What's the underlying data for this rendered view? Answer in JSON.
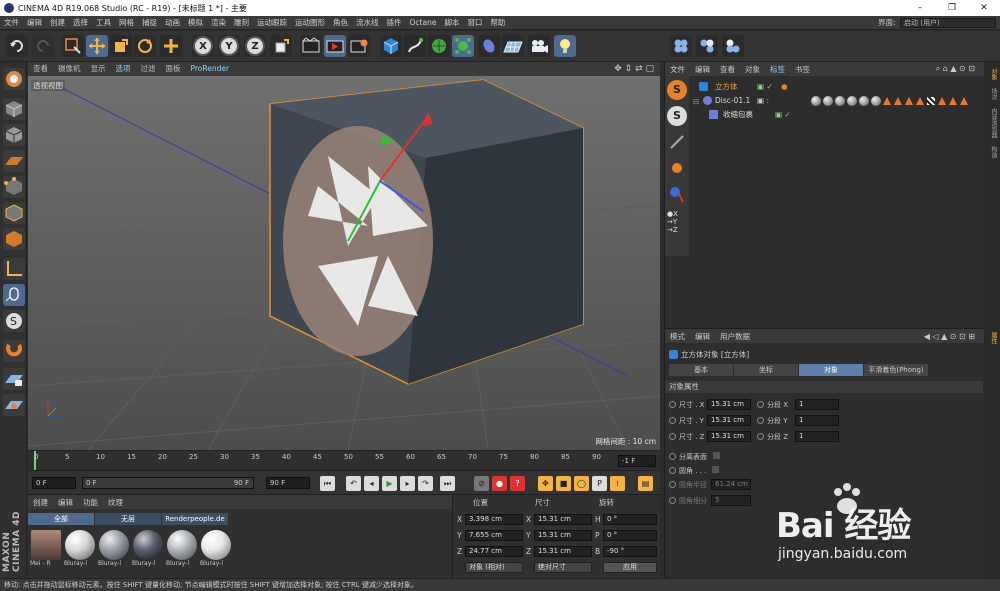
{
  "window": {
    "title": "CINEMA 4D R19.068 Studio (RC - R19) - [未标题 1 *] - 主要",
    "minimize": "–",
    "maximize": "❐",
    "close": "✕"
  },
  "menu": {
    "items": [
      "文件",
      "编辑",
      "创建",
      "选择",
      "工具",
      "网格",
      "捕捉",
      "动画",
      "模拟",
      "渲染",
      "雕刻",
      "运动跟踪",
      "运动图形",
      "角色",
      "流水线",
      "插件",
      "Octane",
      "脚本",
      "窗口",
      "帮助"
    ],
    "layout_label": "界面:",
    "layout_value": "启动 (用户)"
  },
  "toolbar": {
    "x_label": "X",
    "y_label": "Y",
    "z_label": "Z"
  },
  "viewport": {
    "menu": [
      "查看",
      "摄像机",
      "显示",
      "选项",
      "过滤",
      "面板",
      "ProRender"
    ],
    "active_menu_index": 3,
    "label": "透视视图",
    "grid_spacing": "网格间距 : 10 cm"
  },
  "timeline": {
    "ticks": [
      "0",
      "5",
      "10",
      "15",
      "20",
      "25",
      "30",
      "35",
      "40",
      "45",
      "50",
      "55",
      "60",
      "65",
      "70",
      "75",
      "80",
      "85",
      "90"
    ],
    "end_frame": "-1 F",
    "start_field": "0 F",
    "range_start": "0 F",
    "range_end": "90 F",
    "max_field": "90 F"
  },
  "materials": {
    "tabs": [
      "创建",
      "编辑",
      "功能",
      "纹理"
    ],
    "layers": [
      "全部",
      "无层",
      "Renderpeople.de"
    ],
    "items": [
      {
        "name": "Mei - R",
        "color": "#8a6a5a"
      },
      {
        "name": "Bluray-l",
        "color": "#d8d8d8"
      },
      {
        "name": "Bluray-l",
        "color": "#9aa0aa"
      },
      {
        "name": "Bluray-l",
        "color": "#5a6070"
      },
      {
        "name": "Bluray-l",
        "color": "#b0b4b8"
      },
      {
        "name": "Bluray-l",
        "color": "#e8e8e8"
      }
    ]
  },
  "coordinates": {
    "headers": {
      "position": "位置",
      "size": "尺寸",
      "rotation": "旋转"
    },
    "rows": [
      {
        "axis": "X",
        "pos": "3.398 cm",
        "size_axis": "X",
        "size": "15.31 cm",
        "rot_axis": "H",
        "rot": "0 °"
      },
      {
        "axis": "Y",
        "pos": "7.655 cm",
        "size_axis": "Y",
        "size": "15.31 cm",
        "rot_axis": "P",
        "rot": "0 °"
      },
      {
        "axis": "Z",
        "pos": "24.77 cm",
        "size_axis": "Z",
        "size": "15.31 cm",
        "rot_axis": "B",
        "rot": "-90 °"
      }
    ],
    "mode": "对象 (相对)",
    "size_mode": "绝对尺寸",
    "apply": "应用"
  },
  "objects": {
    "menu": [
      "文件",
      "编辑",
      "查看",
      "对象",
      "标签",
      "书签"
    ],
    "rows": [
      {
        "name": "立方体",
        "color": "#f0a030"
      },
      {
        "name": "Disc-01.1",
        "color": "#c8c8c8"
      },
      {
        "name": "收缩包裹",
        "color": "#c8c8c8"
      }
    ]
  },
  "right_tabs": [
    "对象",
    "场次",
    "内容浏览器",
    "构造"
  ],
  "attributes": {
    "menu": [
      "模式",
      "编辑",
      "用户数据"
    ],
    "title": "立方体对象 [立方体]",
    "tabs": [
      "基本",
      "坐标",
      "对象",
      "平滑着色(Phong)"
    ],
    "active_tab_index": 2,
    "section": "对象属性",
    "rows": [
      {
        "label": "尺寸 . X",
        "value": "15.31 cm",
        "seg_label": "分段 X",
        "seg": "1"
      },
      {
        "label": "尺寸 . Y",
        "value": "15.31 cm",
        "seg_label": "分段 Y",
        "seg": "1"
      },
      {
        "label": "尺寸 . Z",
        "value": "15.31 cm",
        "seg_label": "分段 Z",
        "seg": "1"
      }
    ],
    "separate_faces": "分离表面",
    "fillet": "圆角 . . .",
    "fillet_radius_label": "圆角半径",
    "fillet_radius": "61.24 cm",
    "fillet_subdiv_label": "圆角细分",
    "fillet_subdiv": "5",
    "side_tab": "属性"
  },
  "status": "移动: 点击并拖动鼠标移动元素。按住 SHIFT 键量化移动; 节点编辑模式时按住 SHIFT 键增加选择对象; 按住 CTRL 键减少选择对象。",
  "side_brand": "MAXON CINEMA 4D",
  "watermark": {
    "brand": "Bai 经验",
    "url": "jingyan.baidu.com"
  }
}
